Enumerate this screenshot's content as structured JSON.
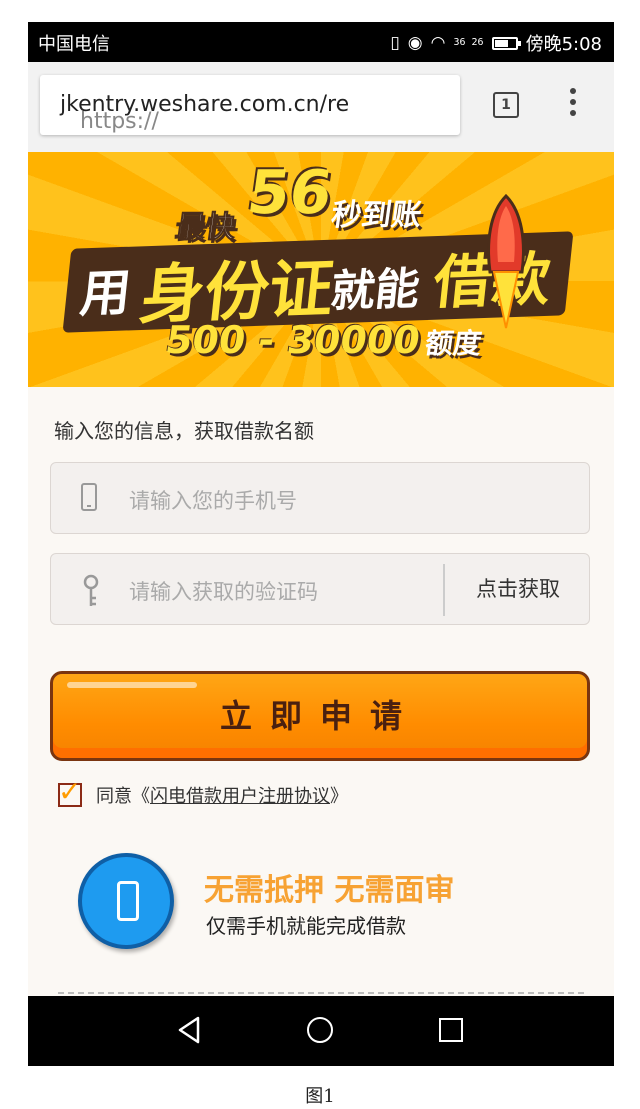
{
  "status_bar": {
    "carrier": "中国电信",
    "signal_text": "36 26",
    "time": "傍晚5:08",
    "icons": [
      "vibrate-icon",
      "eye-icon",
      "wifi-icon",
      "signal-icon",
      "battery-icon"
    ]
  },
  "browser": {
    "url_scheme": "https://",
    "url_host": "jkentry.weshare.com.cn/re",
    "tab_count": "1"
  },
  "banner": {
    "line1_prefix": "最快",
    "line1_number": "56",
    "line1_suffix": "秒到账",
    "line2": [
      "用",
      "身份证",
      "就能",
      "借款"
    ],
    "range": "500 - 30000",
    "range_unit": "额度"
  },
  "form": {
    "title": "输入您的信息，获取借款名额",
    "phone_placeholder": "请输入您的手机号",
    "code_placeholder": "请输入获取的验证码",
    "get_code_label": "点击获取",
    "apply_label": "立即申请",
    "agree_prefix": "同意《",
    "agree_link": "闪电借款用户注册协议",
    "agree_suffix": "》",
    "agreed": true
  },
  "promo": {
    "title": "无需抵押 无需面审",
    "subtitle": "仅需手机就能完成借款"
  },
  "caption": "图1",
  "colors": {
    "accent_orange": "#ff8c00",
    "banner_yellow": "#ffc21c",
    "promo_text": "#f7a233",
    "icon_blue": "#1e9bf0"
  }
}
